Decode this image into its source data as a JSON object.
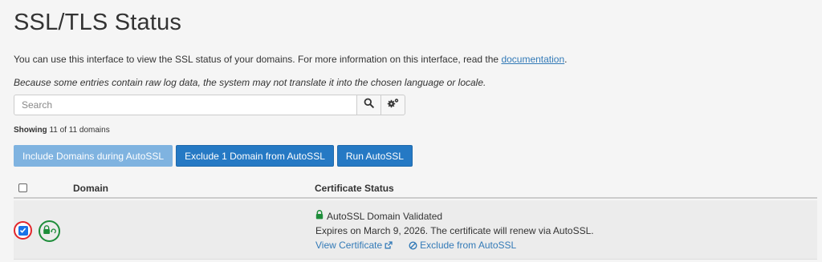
{
  "page": {
    "title": "SSL/TLS Status",
    "intro_text": "You can use this interface to view the SSL status of your domains. For more information on this interface, read the ",
    "intro_link": "documentation",
    "intro_end": ".",
    "note": "Because some entries contain raw log data, the system may not translate it into the chosen language or locale."
  },
  "search": {
    "placeholder": "Search",
    "value": ""
  },
  "showing": {
    "label": "Showing",
    "text": "11 of 11 domains"
  },
  "actions": {
    "include_label": "Include Domains during AutoSSL",
    "exclude_label": "Exclude 1 Domain from AutoSSL",
    "run_label": "Run AutoSSL"
  },
  "table": {
    "headers": {
      "domain": "Domain",
      "status": "Certificate Status"
    },
    "rows": [
      {
        "checked": true,
        "domain": "",
        "status_title": "AutoSSL Domain Validated",
        "expires": "Expires on March 9, 2026. The certificate will renew via AutoSSL.",
        "view_link": "View Certificate",
        "exclude_link": "Exclude from AutoSSL"
      }
    ]
  },
  "icons": {
    "search": "search-icon",
    "settings": "gears-icon",
    "lock": "lock-icon",
    "external": "external-link-icon",
    "ban": "ban-icon"
  },
  "colors": {
    "primary": "#2579c4",
    "primary_light": "#7fb3e0",
    "link": "#337ab7",
    "success": "#1e8d3a",
    "highlight_ring": "#e2262b"
  }
}
